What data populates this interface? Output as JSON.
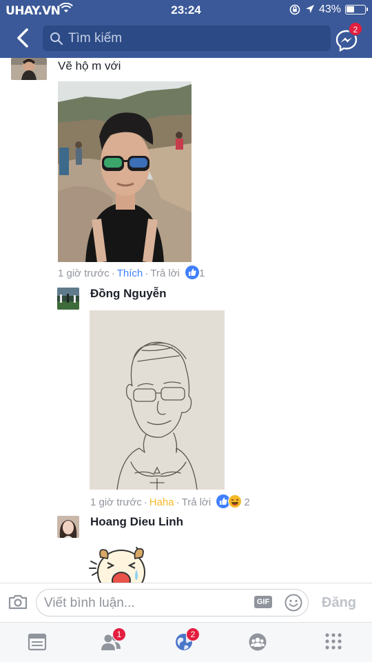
{
  "status_bar": {
    "watermark": "UHAY.VN",
    "time": "23:24",
    "battery_percent": "43%",
    "battery_level": 0.43
  },
  "header": {
    "search_placeholder": "Tìm kiếm",
    "messenger_badge": "2"
  },
  "comments": [
    {
      "text": "Vẽ hộ m với",
      "time": "1 giờ trước",
      "reaction_action": "Thích",
      "reply": "Trả lời",
      "reaction_count": "1"
    },
    {
      "name": "Đồng Nguyễn",
      "time": "1 giờ trước",
      "reaction_action": "Haha",
      "reply": "Trả lời",
      "reaction_count": "2"
    },
    {
      "name": "Hoang Dieu Linh"
    }
  ],
  "composer": {
    "placeholder": "Viết bình luận...",
    "gif_label": "GIF",
    "post_label": "Đăng"
  },
  "tabs": {
    "friend_requests_badge": "1",
    "notifications_badge": "2"
  },
  "colors": {
    "header_bg": "#3b5998",
    "like_blue": "#4080ff",
    "haha_yellow": "#f7b928",
    "badge_red": "#e41e3f"
  }
}
